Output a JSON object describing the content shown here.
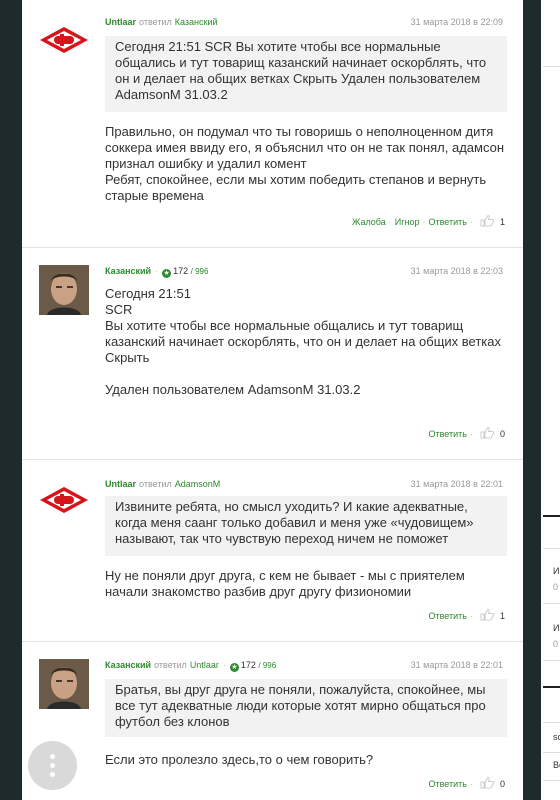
{
  "comments": [
    {
      "author": "Untlaar",
      "replied_label": "ответил",
      "reply_to": "Казанский",
      "date": "31 марта 2018 в 22:09",
      "quote": "Сегодня 21:51 SCR Вы хотите чтобы все нормальные общались и тут товарищ казанский начинает оскорблять, что он и делает на общих ветках Скрыть Удален пользователем AdamsonM 31.03.2",
      "text": "Правильно, он подумал что ты говоришь о неполноценном дитя соккера имея ввиду его, я объяснил что он не так понял, адамсон признал ошибку и удалил комент\nРебят, спокойнее, если мы хотим победить степанов и вернуть старые времена",
      "complain": "Жалоба",
      "ignore": "Игнор",
      "reply": "Ответить",
      "likes": "1"
    },
    {
      "author": "Казанский",
      "rating": "172",
      "rating_max": "/ 996",
      "date": "31 марта 2018 в 22:03",
      "text": "Сегодня 21:51\nSCR\nВы хотите чтобы все нормальные общались и тут товарищ казанский начинает оскорблять, что он и делает на общих ветках\nСкрыть\n\nУдален пользователем AdamsonM 31.03.2",
      "reply": "Ответить",
      "likes": "0"
    },
    {
      "author": "Untlaar",
      "replied_label": "ответил",
      "reply_to": "AdamsonM",
      "date": "31 марта 2018 в 22:01",
      "quote": "Извините ребята, но смысл уходить? И какие адекватные, когда меня саанг только добавил и меня уже «чудовищем» называют, так что чувствую переход ничем не поможет",
      "text": "Ну не поняли друг друга, с кем не бывает - мы с приятелем начали знакомство разбив друг другу физиономии",
      "reply": "Ответить",
      "likes": "1"
    },
    {
      "author": "Казанский",
      "replied_label": "ответил",
      "reply_to": "Untlaar",
      "rating": "172",
      "rating_max": "/ 996",
      "date": "31 марта 2018 в 22:01",
      "quote": "Братья, вы друг друга не поняли, пожалуйста, спокойнее, мы все тут адекватные люди которые хотят мирно общаться про футбол без клонов",
      "text": "Если это пролезло здесь,то о чем говорить?",
      "reply": "Ответить",
      "likes": "0"
    }
  ],
  "right_column": {
    "item_a": "И",
    "item_b": "0",
    "item_c": "И",
    "item_d": "0",
    "item_e": "sc",
    "item_f": "Ве"
  },
  "colors": {
    "accent": "#2d8a2d",
    "logo_red": "#d7141a"
  },
  "icons": {
    "club_logo": "spartak-logo-icon",
    "like": "thumb-up-icon",
    "menu": "more-vertical-icon"
  }
}
